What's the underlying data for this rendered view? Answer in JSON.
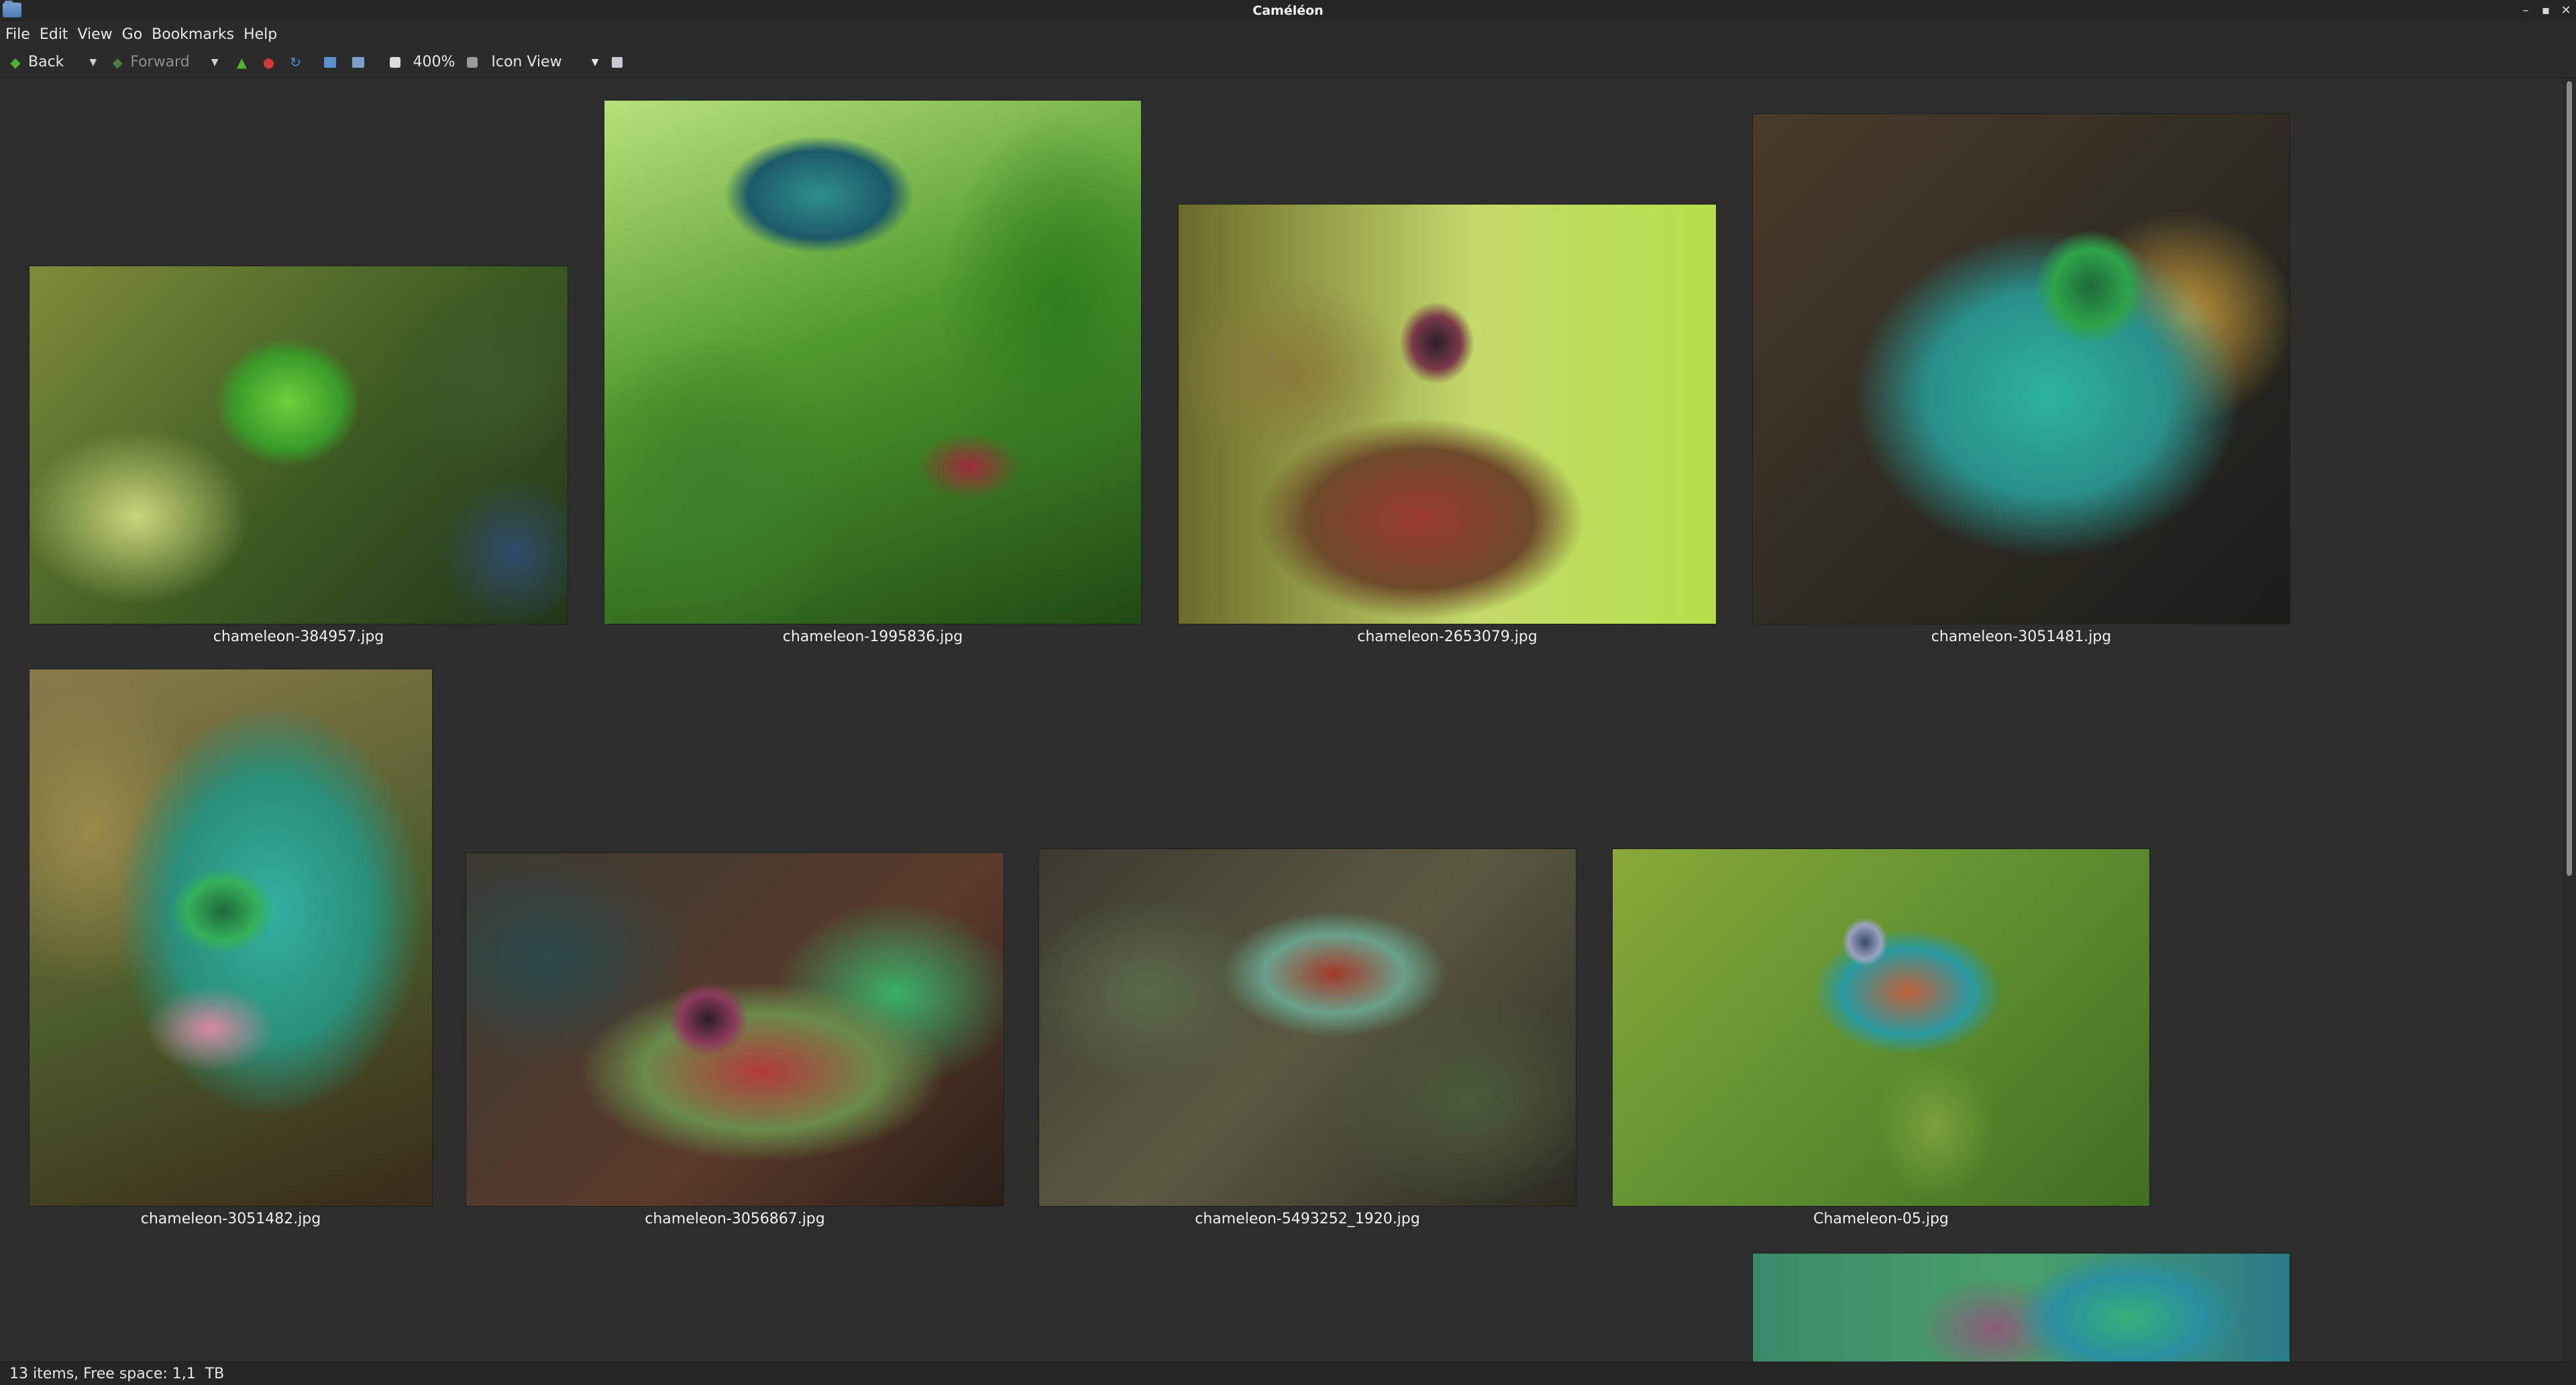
{
  "window": {
    "title": "Caméléon"
  },
  "menu": [
    "File",
    "Edit",
    "View",
    "Go",
    "Bookmarks",
    "Help"
  ],
  "toolbar": {
    "back_label": "Back",
    "forward_label": "Forward",
    "zoom_label": "400%",
    "view_mode": "Icon View"
  },
  "files": [
    "chameleon-384957.jpg",
    "chameleon-1995836.jpg",
    "chameleon-2653079.jpg",
    "chameleon-3051481.jpg",
    "chameleon-3051482.jpg",
    "chameleon-3056867.jpg",
    "chameleon-5493252_1920.jpg",
    "Chameleon-05.jpg"
  ],
  "status": {
    "text": "13 items, Free space: 1,1  TB"
  },
  "colors": {
    "background": "#2d2d2d",
    "accent_green": "#4fb334"
  }
}
